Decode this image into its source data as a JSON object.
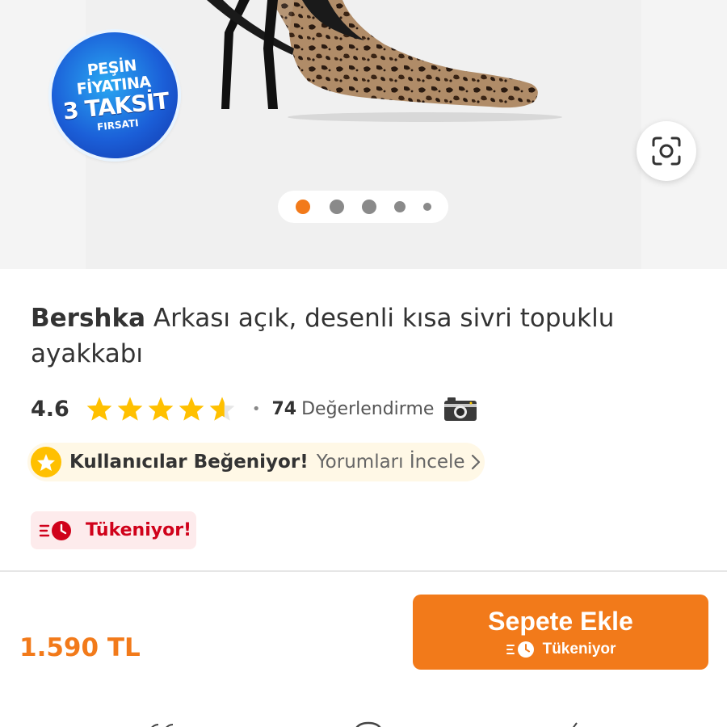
{
  "gallery": {
    "badge": {
      "line1": "PEŞİN",
      "line2": "FİYATINA",
      "line3": "3 TAKSİT",
      "line4": "FIRSATI"
    },
    "lens_icon": "scan-camera-icon",
    "dots_count": 5,
    "active_dot": 0
  },
  "product": {
    "brand": "Bershka",
    "name": "Arkası açık, desenli kısa sivri topuklu ayakkabı"
  },
  "rating": {
    "value": "4.6",
    "stars": 4.6,
    "separator": "•",
    "review_count": "74",
    "review_label": "Değerlendirme",
    "photo_icon": "camera-icon"
  },
  "liked_banner": {
    "title": "Kullanıcılar Beğeniyor!",
    "link": "Yorumları İncele",
    "icon": "star-icon"
  },
  "selling_fast": {
    "label": "Tükeniyor!",
    "icon": "fast-clock-icon"
  },
  "bottom_bar": {
    "price": "1.590 TL",
    "cart_button": "Sepete Ekle",
    "cart_sub": "Tükeniyor"
  },
  "colors": {
    "accent": "#f27a1a",
    "star": "#ffc000",
    "danger": "#d0021b",
    "danger_bg": "#fdebec",
    "banner_bg": "#fff8e6"
  }
}
